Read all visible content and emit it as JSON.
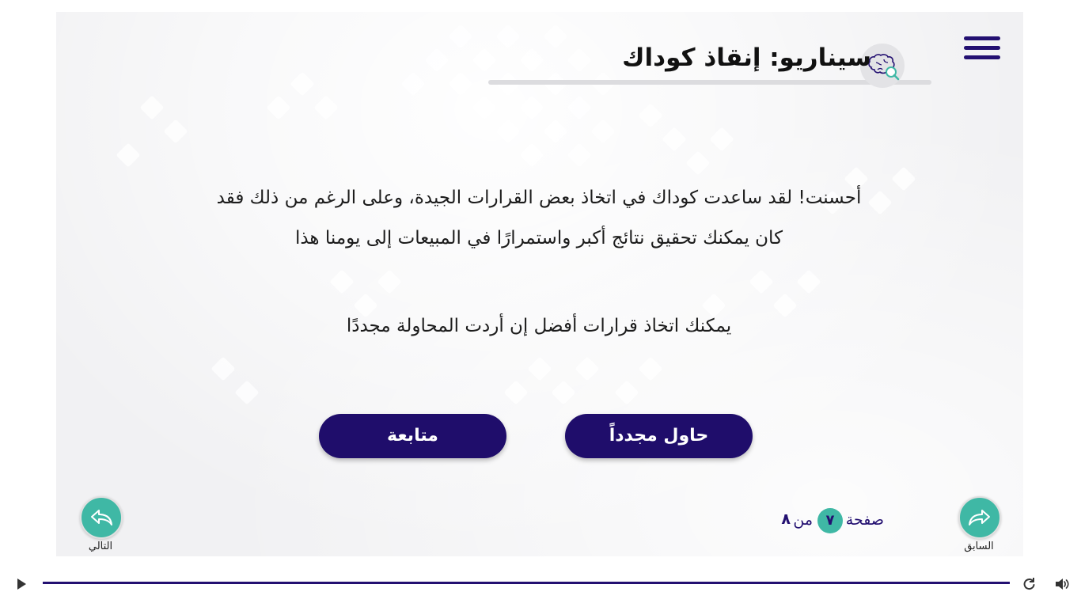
{
  "header": {
    "title": "سيناريو: إنقاذ كوداك",
    "menu_icon": "hamburger-menu-icon",
    "title_icon": "brain-search-icon"
  },
  "main": {
    "feedback_line1": "أحسنت! لقد ساعدت كوداك في اتخاذ بعض القرارات الجيدة، وعلى الرغم من ذلك فقد",
    "feedback_line2": "كان يمكنك تحقيق نتائج أكبر واستمرارًا في المبيعات إلى يومنا هذا",
    "retry_hint": "يمكنك اتخاذ قرارات أفضل إن أردت المحاولة مجددًا"
  },
  "buttons": {
    "continue_label": "متابعة",
    "retry_label": "حاول مجدداً"
  },
  "navigation": {
    "next_label": "التالي",
    "prev_label": "السابق",
    "next_icon": "reply-arrow-icon",
    "prev_icon": "forward-arrow-icon"
  },
  "pagination": {
    "word": "صفحة",
    "current": "٧",
    "of_word": "من",
    "total": "٨"
  },
  "player": {
    "progress": 1.0,
    "play_icon": "play-icon",
    "replay_icon": "replay-icon",
    "volume_icon": "volume-icon"
  },
  "colors": {
    "primary": "#1f0d6b",
    "accent": "#3fb8a5",
    "background": "#f1f1f3"
  }
}
